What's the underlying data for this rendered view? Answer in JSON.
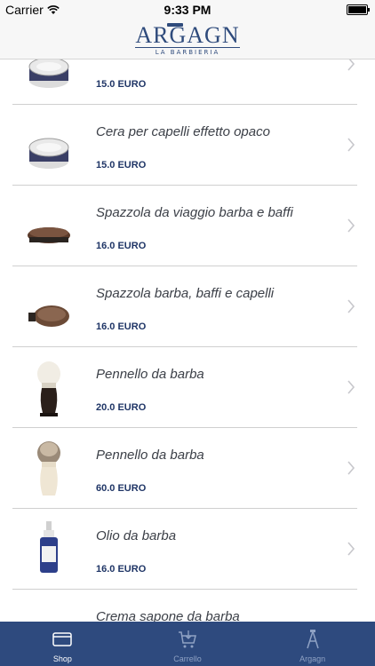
{
  "status_bar": {
    "carrier": "Carrier",
    "time": "9:33 PM"
  },
  "header": {
    "brand": "ARGAGN",
    "subtitle": "LA BARBIERIA"
  },
  "products": [
    {
      "name": "",
      "price": "15.0 EURO",
      "image": "wax-tin"
    },
    {
      "name": "Cera per capelli effetto opaco",
      "price": "15.0 EURO",
      "image": "wax-tin"
    },
    {
      "name": "Spazzola da viaggio barba e baffi",
      "price": "16.0 EURO",
      "image": "beard-brush"
    },
    {
      "name": "Spazzola barba, baffi e capelli",
      "price": "16.0 EURO",
      "image": "oval-brush"
    },
    {
      "name": "Pennello da barba",
      "price": "20.0 EURO",
      "image": "shaving-brush-dark"
    },
    {
      "name": "Pennello da barba",
      "price": "60.0 EURO",
      "image": "shaving-brush-light"
    },
    {
      "name": "Olio da barba",
      "price": "16.0 EURO",
      "image": "oil-bottle"
    },
    {
      "name": "Crema sapone da barba",
      "price": "",
      "image": "cream-jar"
    }
  ],
  "tabs": [
    {
      "label": "Shop",
      "icon": "card-icon",
      "active": true
    },
    {
      "label": "Carrello",
      "icon": "cart-icon",
      "active": false
    },
    {
      "label": "Argagn",
      "icon": "barber-logo-icon",
      "active": false
    }
  ]
}
